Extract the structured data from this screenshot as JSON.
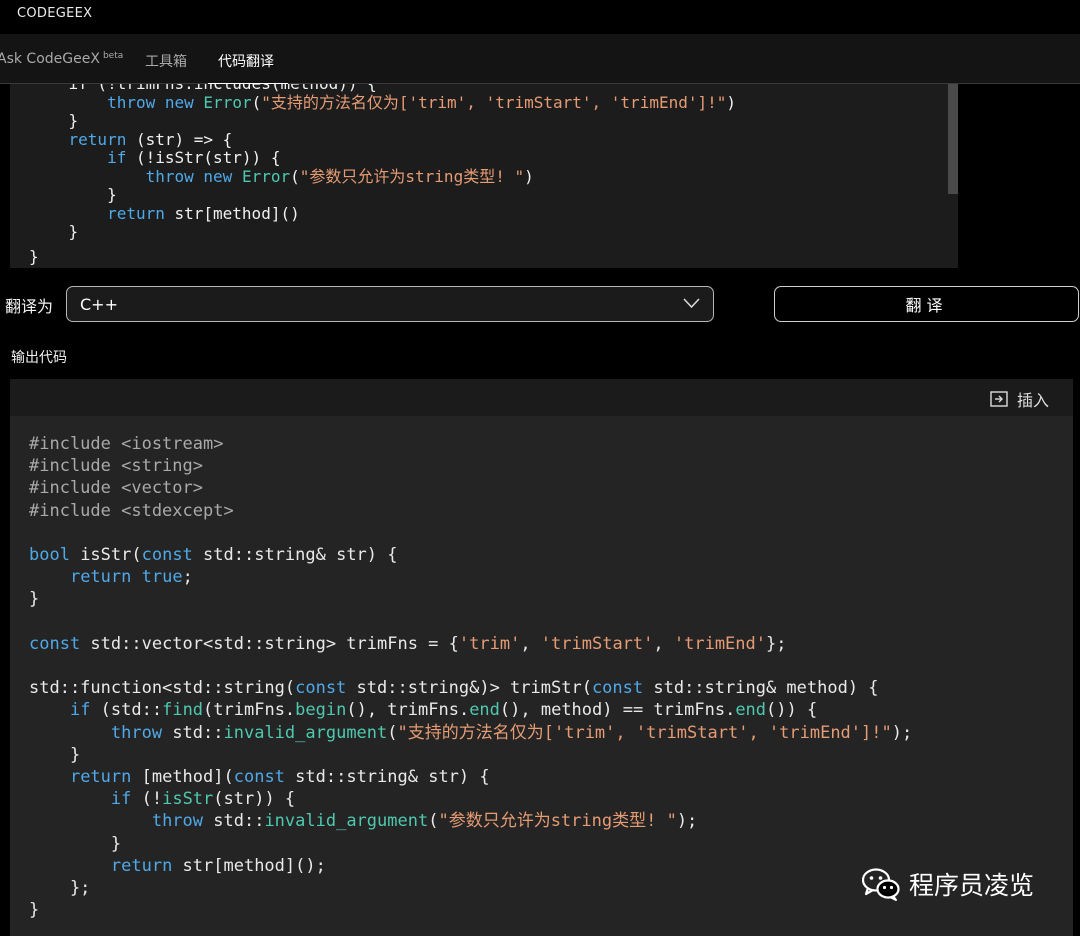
{
  "app": {
    "title": "CODEGEEX"
  },
  "tabs": [
    {
      "label": "Ask CodeGeeX",
      "badge": "beta"
    },
    {
      "label": "工具箱"
    },
    {
      "label": "代码翻译"
    }
  ],
  "source_code": {
    "lines": [
      "    if (!trimFns.includes(method)) {",
      "        throw new Error(\"支持的方法名仅为['trim', 'trimStart', 'trimEnd']!\")",
      "    }",
      "    return (str) => {",
      "        if (!isStr(str)) {",
      "            throw new Error(\"参数只允许为string类型! \")",
      "        }",
      "        return str[method]()",
      "    }"
    ],
    "closing": "}"
  },
  "translate": {
    "label": "翻译为",
    "selected_language": "C++",
    "button_label": "翻译"
  },
  "output": {
    "label": "输出代码",
    "insert_label": "插入",
    "code_lines": [
      [
        [
          "pp",
          "#include <iostream>"
        ]
      ],
      [
        [
          "pp",
          "#include <string>"
        ]
      ],
      [
        [
          "pp",
          "#include <vector>"
        ]
      ],
      [
        [
          "pp",
          "#include <stdexcept>"
        ]
      ],
      [],
      [
        [
          "ty",
          "bool"
        ],
        [
          "tx",
          " isStr("
        ],
        [
          "kw",
          "const"
        ],
        [
          "tx",
          " std::string& str) {"
        ]
      ],
      [
        [
          "tx",
          "    "
        ],
        [
          "kw",
          "return"
        ],
        [
          "tx",
          " "
        ],
        [
          "kw",
          "true"
        ],
        [
          "tx",
          ";"
        ]
      ],
      [
        [
          "tx",
          "}"
        ]
      ],
      [],
      [
        [
          "kw",
          "const"
        ],
        [
          "tx",
          " std::vector<std::string> trimFns = {"
        ],
        [
          "str",
          "'trim'"
        ],
        [
          "tx",
          ", "
        ],
        [
          "str",
          "'trimStart'"
        ],
        [
          "tx",
          ", "
        ],
        [
          "str",
          "'trimEnd'"
        ],
        [
          "tx",
          "};"
        ]
      ],
      [],
      [
        [
          "tx",
          "std::function<std::string("
        ],
        [
          "kw",
          "const"
        ],
        [
          "tx",
          " std::string&)> trimStr("
        ],
        [
          "kw",
          "const"
        ],
        [
          "tx",
          " std::string& method) {"
        ]
      ],
      [
        [
          "tx",
          "    "
        ],
        [
          "kw",
          "if"
        ],
        [
          "tx",
          " (std::"
        ],
        [
          "fn",
          "find"
        ],
        [
          "tx",
          "(trimFns."
        ],
        [
          "fn",
          "begin"
        ],
        [
          "tx",
          "(), trimFns."
        ],
        [
          "fn",
          "end"
        ],
        [
          "tx",
          "(), method) == trimFns."
        ],
        [
          "fn",
          "end"
        ],
        [
          "tx",
          "()) {"
        ]
      ],
      [
        [
          "tx",
          "        "
        ],
        [
          "kw",
          "throw"
        ],
        [
          "tx",
          " std::"
        ],
        [
          "fn",
          "invalid_argument"
        ],
        [
          "tx",
          "("
        ],
        [
          "str",
          "\"支持的方法名仅为['trim', 'trimStart', 'trimEnd']!\""
        ],
        [
          "tx",
          ");"
        ]
      ],
      [
        [
          "tx",
          "    }"
        ]
      ],
      [
        [
          "tx",
          "    "
        ],
        [
          "kw",
          "return"
        ],
        [
          "tx",
          " [method]("
        ],
        [
          "kw",
          "const"
        ],
        [
          "tx",
          " std::string& str) {"
        ]
      ],
      [
        [
          "tx",
          "        "
        ],
        [
          "kw",
          "if"
        ],
        [
          "tx",
          " (!"
        ],
        [
          "fn",
          "isStr"
        ],
        [
          "tx",
          "(str)) {"
        ]
      ],
      [
        [
          "tx",
          "            "
        ],
        [
          "kw",
          "throw"
        ],
        [
          "tx",
          " std::"
        ],
        [
          "fn",
          "invalid_argument"
        ],
        [
          "tx",
          "("
        ],
        [
          "str",
          "\"参数只允许为string类型! \""
        ],
        [
          "tx",
          ");"
        ]
      ],
      [
        [
          "tx",
          "        }"
        ]
      ],
      [
        [
          "tx",
          "        "
        ],
        [
          "kw",
          "return"
        ],
        [
          "tx",
          " str[method]();"
        ]
      ],
      [
        [
          "tx",
          "    };"
        ]
      ],
      [
        [
          "tx",
          "}"
        ]
      ]
    ]
  },
  "watermark": {
    "text": "程序员凌览",
    "icon": "wechat-icon"
  },
  "colors": {
    "keyword": "#4fa9e8",
    "string": "#e59b74",
    "function": "#4ec9b0",
    "preprocessor": "#a9a9a9",
    "panel_bg": "#242424"
  }
}
